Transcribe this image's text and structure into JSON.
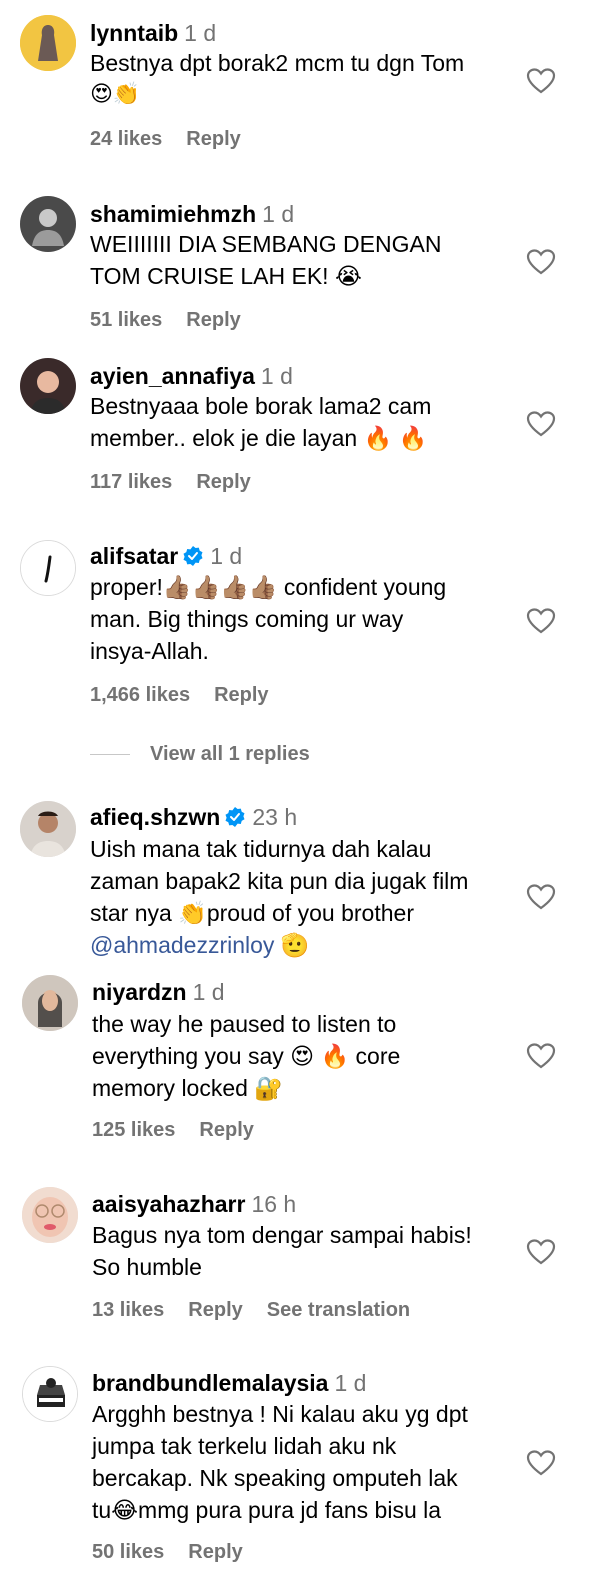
{
  "comments": [
    {
      "username": "lynntaib",
      "time": "1 d",
      "verified": false,
      "lines": [
        "Bestnya dpt borak2 mcm tu dgn Tom",
        "😍👏"
      ],
      "likes": "24 likes",
      "reply": "Reply"
    },
    {
      "username": "shamimiehmzh",
      "time": "1 d",
      "verified": false,
      "lines": [
        "WEIIIIIII DIA SEMBANG DENGAN",
        "TOM CRUISE LAH EK! 😭"
      ],
      "likes": "51 likes",
      "reply": "Reply"
    },
    {
      "username": "ayien_annafiya",
      "time": "1 d",
      "verified": false,
      "lines": [
        "Bestnyaaa bole borak lama2 cam",
        "member.. elok je die layan 🔥 🔥"
      ],
      "likes": "117 likes",
      "reply": "Reply"
    },
    {
      "username": "alifsatar",
      "time": "1 d",
      "verified": true,
      "lines": [
        "proper!👍🏽👍🏽👍🏽👍🏽 confident young",
        "man. Big things coming ur way",
        "insya-Allah."
      ],
      "likes": "1,466 likes",
      "reply": "Reply",
      "view_replies": "View all 1 replies"
    },
    {
      "username": "afieq.shzwn",
      "time": "23 h",
      "verified": true,
      "lines": [
        "Uish mana tak tidurnya dah kalau",
        "zaman bapak2 kita pun dia jugak film",
        "star nya 👏proud of you brother"
      ],
      "mention": "@ahmadezzrinloy",
      "mention_suffix": "🫡"
    },
    {
      "username": "niyardzn",
      "time": "1 d",
      "verified": false,
      "lines": [
        "the way he paused to listen to",
        "everything you say 😍 🔥 core",
        "memory locked 🔐"
      ],
      "likes": "125 likes",
      "reply": "Reply"
    },
    {
      "username": "aaisyahazharr",
      "time": "16 h",
      "verified": false,
      "lines": [
        "Bagus nya tom dengar sampai habis!",
        "So humble"
      ],
      "likes": "13 likes",
      "reply": "Reply",
      "see_translation": "See translation"
    },
    {
      "username": "brandbundlemalaysia",
      "time": "1 d",
      "verified": false,
      "lines": [
        "Argghh bestnya ! Ni kalau aku yg dpt",
        "jumpa tak terkelu lidah aku nk",
        "bercakap. Nk speaking omputeh lak",
        "tu😂mmg pura pura jd fans bisu la"
      ],
      "likes": "50 likes",
      "reply": "Reply"
    }
  ],
  "colors": {
    "secondary": "#737373",
    "mention": "#385898",
    "verified": "#0095f6"
  },
  "icons": {
    "like": "heart-outline-icon",
    "verified": "verified-badge-icon"
  }
}
